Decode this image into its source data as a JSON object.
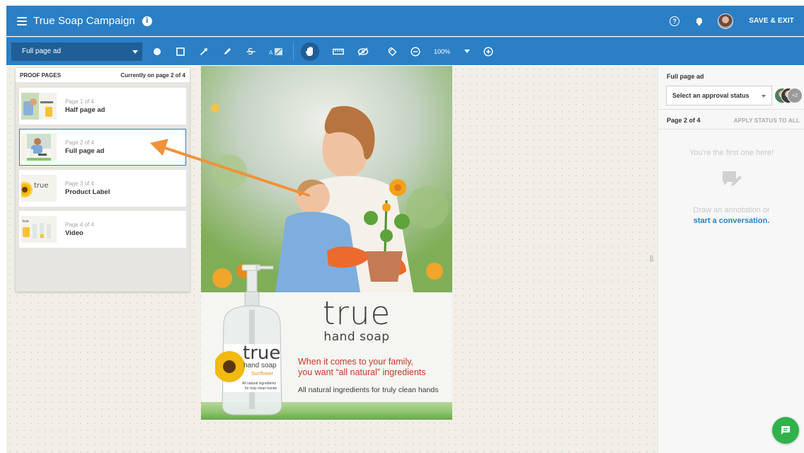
{
  "header": {
    "title": "True Soap Campaign",
    "save_exit_label": "SAVE & EXIT"
  },
  "toolbar": {
    "page_selector_value": "Full page ad",
    "zoom": "100%"
  },
  "proof_pages": {
    "heading": "PROOF PAGES",
    "current": "Currently on page 2 of 4",
    "pages": [
      {
        "num": "Page 1 of 4",
        "name": "Half page ad"
      },
      {
        "num": "Page 2 of 4",
        "name": "Full page ad"
      },
      {
        "num": "Page 3 of 4",
        "name": "Product Label"
      },
      {
        "num": "Page 4 of 4",
        "name": "Video"
      }
    ]
  },
  "ad": {
    "brand": "true",
    "tagline": "hand soap",
    "bottle_brand": "true",
    "bottle_tagline": "hand soap",
    "bottle_variant": "Sunflower",
    "bottle_small1": "All natural ingredients",
    "bottle_small2": "for truly clean hands",
    "headline1": "When it comes to your family,",
    "headline2": "you want “all natural” ingredients",
    "subline": "All natural ingredients for truly clean hands"
  },
  "sidebar": {
    "title": "Full page ad",
    "approval_placeholder": "Select an approval status",
    "extra_reviewers": "+2",
    "page_label": "Page 2 of 4",
    "apply_all": "APPLY STATUS TO ALL",
    "first_one": "You're the first one here!",
    "draw_prompt": "Draw an annotation or",
    "start_link": "start a conversation."
  },
  "colors": {
    "primary": "#2b7fc4",
    "accent_arrow": "#f0923a",
    "fab": "#2fb24c",
    "headline": "#c0392b"
  }
}
